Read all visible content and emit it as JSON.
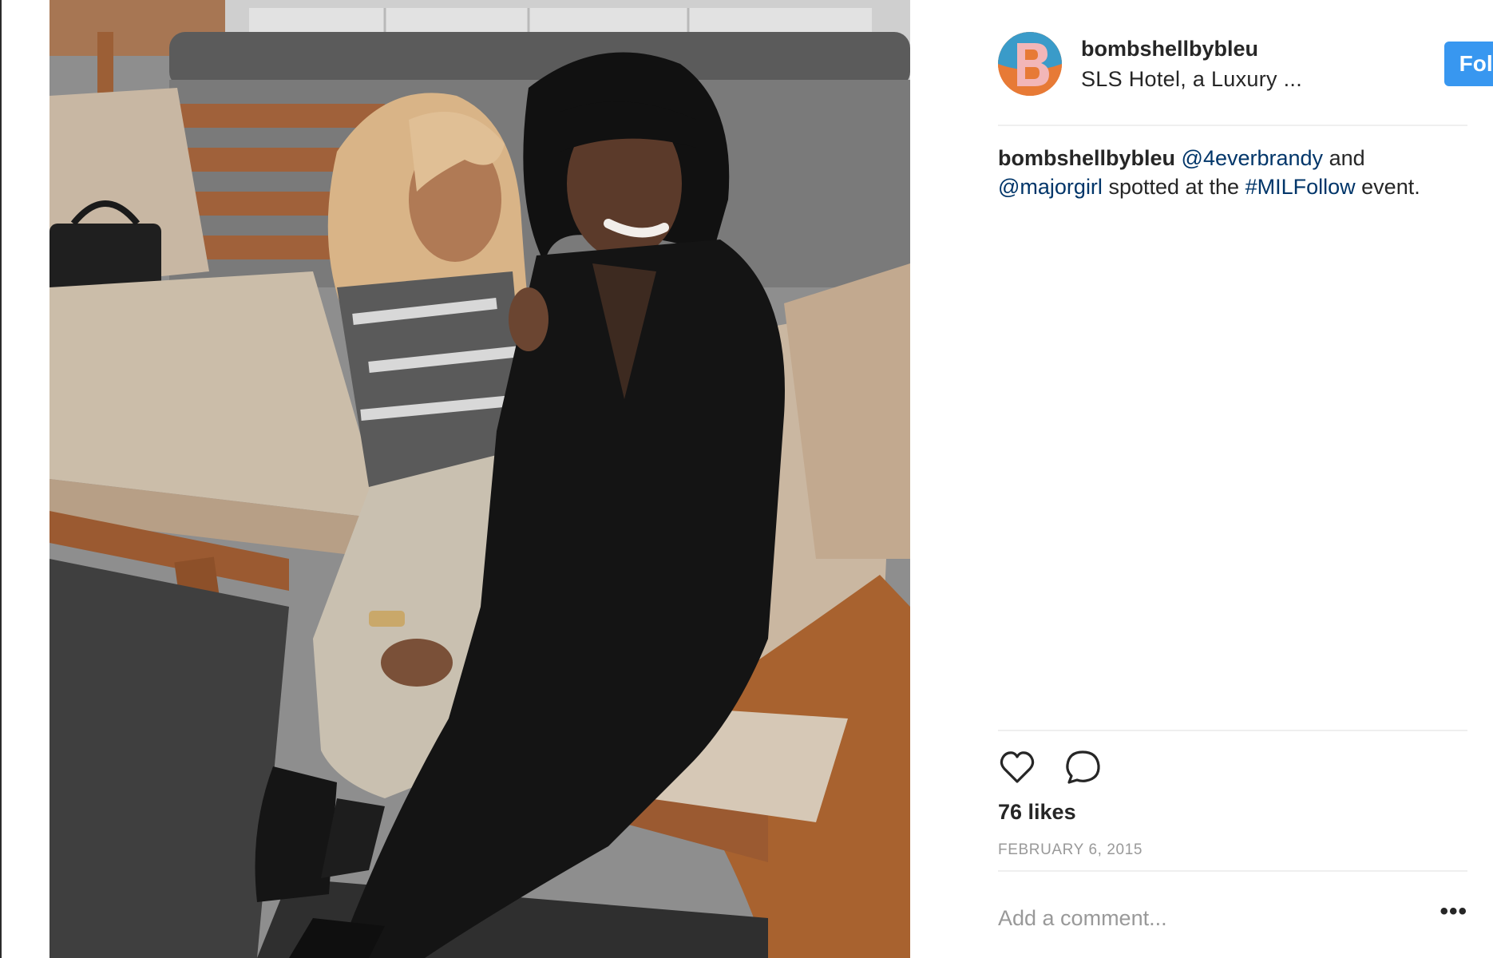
{
  "post": {
    "username": "bombshellbybleu",
    "location": "SLS Hotel, a Luxury ...",
    "follow_label": "Follow",
    "caption": {
      "username": "bombshellbybleu",
      "mention1": "@4everbrandy",
      "text1": "and",
      "mention2": "@majorgirl",
      "text2": "spotted at the",
      "hashtag": "#MILFollow",
      "text3": "event."
    },
    "likes": "76 likes",
    "date": "FEBRUARY 6, 2015",
    "comment_placeholder": "Add a comment...",
    "more_label": "•••"
  },
  "icons": {
    "like": "heart-icon",
    "comment": "comment-bubble-icon",
    "more": "more-options-icon"
  },
  "colors": {
    "follow_button": "#3897f0",
    "link": "#003569",
    "muted": "#999999",
    "text": "#262626"
  }
}
